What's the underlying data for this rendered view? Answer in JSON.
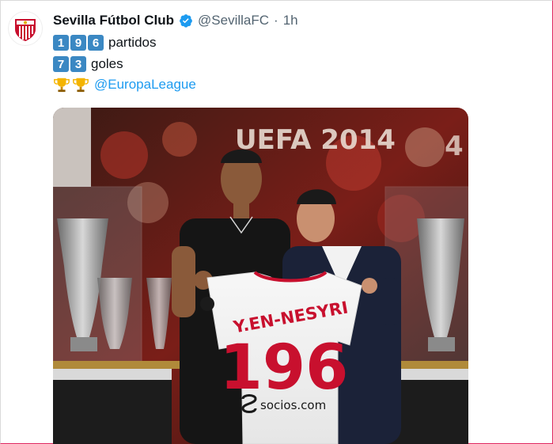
{
  "tweet": {
    "display_name": "Sevilla Fútbol Club",
    "handle": "@SevillaFC",
    "separator": "·",
    "time": "1h",
    "lines": [
      {
        "digits": [
          "1",
          "9",
          "6"
        ],
        "text": "partidos"
      },
      {
        "digits": [
          "7",
          "3"
        ],
        "text": "goles"
      }
    ],
    "mention": "@EuropaLeague"
  },
  "photo": {
    "banner_text": "UEFA 2014",
    "banner_text_right": "4",
    "jersey_name": "Y.EN-NESYRI",
    "jersey_number": "196",
    "sponsor": "socios.com"
  },
  "colors": {
    "verified": "#1d9bf0",
    "key_blue": "#3b88c3",
    "link": "#1d9bf0",
    "sevilla_red": "#c8102e"
  }
}
